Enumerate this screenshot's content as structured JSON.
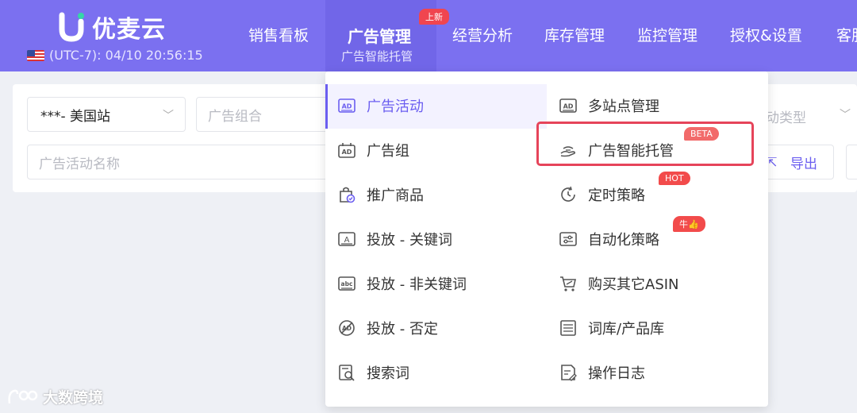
{
  "brand": {
    "name": "优麦云",
    "timezone": "(UTC-7): 04/10 20:56:15"
  },
  "nav": {
    "items": [
      "销售看板",
      "经营分析",
      "库存管理",
      "监控管理",
      "授权&设置",
      "客服"
    ],
    "active": {
      "label": "广告管理",
      "sub_label": "广告智能托管",
      "badge": "上新"
    }
  },
  "filters": {
    "site_select": "***- 美国站",
    "ad_group_placeholder": "广告组合",
    "campaign_name_placeholder": "广告活动名称",
    "right_select_placeholder": "动类型",
    "export_label": "导出"
  },
  "dropdown": {
    "left": [
      {
        "label": "广告活动",
        "icon": "ad-icon",
        "active": true
      },
      {
        "label": "广告组",
        "icon": "ad-group-icon"
      },
      {
        "label": "推广商品",
        "icon": "bag-icon"
      },
      {
        "label": "投放 - 关键词",
        "icon": "keyword-icon"
      },
      {
        "label": "投放 - 非关键词",
        "icon": "abc-icon"
      },
      {
        "label": "投放 - 否定",
        "icon": "negative-ad-icon"
      },
      {
        "label": "搜索词",
        "icon": "search-doc-icon"
      }
    ],
    "right": [
      {
        "label": "多站点管理",
        "icon": "ad-icon"
      },
      {
        "label": "广告智能托管",
        "icon": "hand-icon",
        "tag": "BETA"
      },
      {
        "label": "定时策略",
        "icon": "clock-icon",
        "tag": "HOT"
      },
      {
        "label": "自动化策略",
        "icon": "sliders-icon",
        "tag": "牛👍"
      },
      {
        "label": "购买其它ASIN",
        "icon": "cart-icon"
      },
      {
        "label": "词库/产品库",
        "icon": "list-icon"
      },
      {
        "label": "操作日志",
        "icon": "log-icon"
      }
    ]
  },
  "watermark": {
    "text": "大数跨境"
  },
  "colors": {
    "header_bg": "#7b70f0",
    "accent": "#6b5ef0",
    "tag_red": "#f24b4b",
    "highlight": "#e6445a"
  }
}
